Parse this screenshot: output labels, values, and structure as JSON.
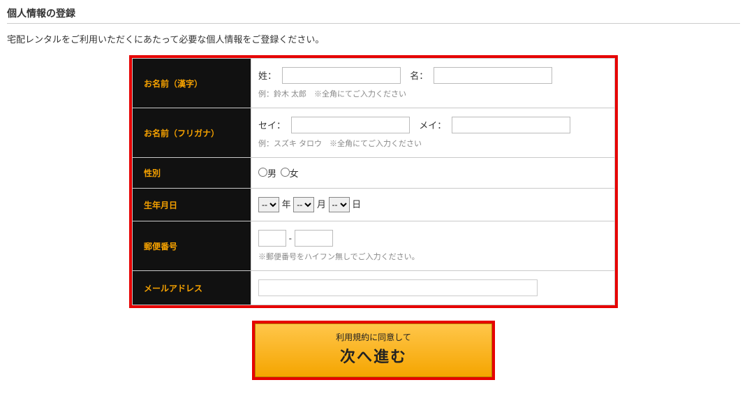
{
  "heading": "個人情報の登録",
  "intro": "宅配レンタルをご利用いただくにあたって必要な個人情報をご登録ください。",
  "rows": {
    "name_kanji": {
      "label": "お名前（漢字）",
      "sei_label": "姓：",
      "mei_label": "名：",
      "hint": "例：鈴木 太郎　※全角にてご入力ください"
    },
    "name_kana": {
      "label": "お名前（フリガナ）",
      "sei_label": "セイ：",
      "mei_label": "メイ：",
      "hint": "例：スズキ タロウ　※全角にてご入力ください"
    },
    "gender": {
      "label": "性別",
      "male": "男",
      "female": "女"
    },
    "birth": {
      "label": "生年月日",
      "year_suffix": "年",
      "month_suffix": "月",
      "day_suffix": "日",
      "placeholder": "--"
    },
    "postal": {
      "label": "郵便番号",
      "sep": "-",
      "hint": "※郵便番号をハイフン無しでご入力ください。"
    },
    "email": {
      "label": "メールアドレス"
    }
  },
  "submit": {
    "line1": "利用規約に同意して",
    "line2": "次へ進む"
  }
}
